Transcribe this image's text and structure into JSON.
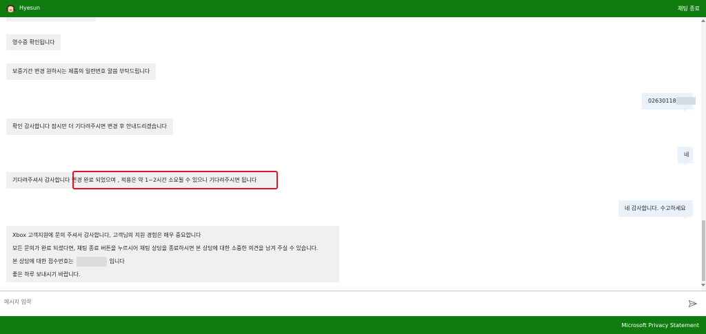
{
  "header": {
    "agent_name": "Hyesun",
    "end_chat_label": "채팅 종료",
    "background_color": "#107c10"
  },
  "messages": [
    {
      "sender": "agent",
      "text": "영수증 확인됩니다"
    },
    {
      "sender": "agent",
      "text": "보증기간 변경 원하시는 제품의 일련번호 말씀 부탁드립니다"
    },
    {
      "sender": "user",
      "text": "02630118"
    },
    {
      "sender": "agent",
      "text": "확인 감사합니다 잠시만 더 기다려주시면 변경 후 안내드리겠습니다"
    },
    {
      "sender": "user",
      "text": "네"
    },
    {
      "sender": "agent",
      "text_prefix": "기다려주셔서 감사합니다 ",
      "text_highlighted": "변경 완료 되었으며 , 적용은 약 1~2시간 소요될 수 있으니 기다려주시면 됩니다"
    },
    {
      "sender": "user",
      "text": "네 감사합니다. 수고하세요"
    },
    {
      "sender": "agent",
      "lines": [
        "Xbox 고객지원에 문의 주셔서 감사합니다, 고객님의 지원 경험은 매우 중요합니다",
        "모든 문의가 완료 되셨다면, 채팅 종료 버튼을 누르시어 채팅 상담을 종료하시면 본 상담에 대한 소중한 의견을 남겨 주실 수 있습니다.",
        "본 상담에 대한 접수번호는",
        "입니다",
        "좋은 하루 보내시기 바랍니다."
      ]
    }
  ],
  "input": {
    "placeholder": "메시지 입력",
    "value": ""
  },
  "footer": {
    "privacy_label": "Microsoft Privacy Statement"
  },
  "colors": {
    "brand_green": "#107c10",
    "agent_bubble": "#f0f0f0",
    "user_bubble": "#e9f2fb",
    "highlight_border": "#e81123"
  }
}
